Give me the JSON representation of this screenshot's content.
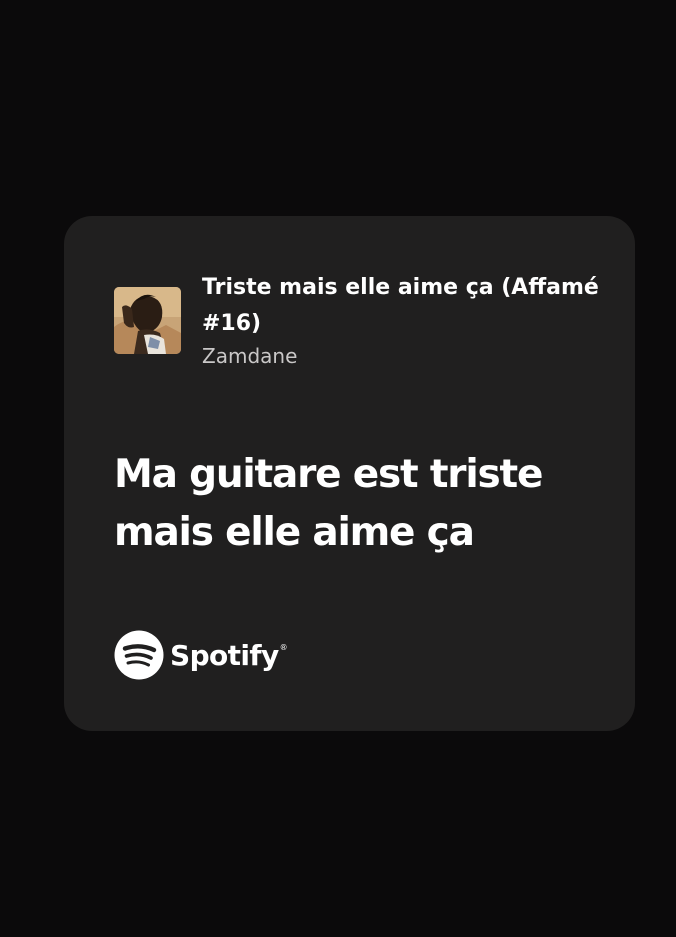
{
  "share_card": {
    "track": {
      "title": "Triste mais elle aime ça (Affamé #16)",
      "artist": "Zamdane",
      "cover_icon": "album-cover-image"
    },
    "lyric": "Ma guitare est triste mais elle aime ça",
    "brand": {
      "icon": "spotify-logo-icon",
      "name": "Spotify",
      "trademark": "®"
    },
    "colors": {
      "page_background": "#0b0a0b",
      "card_background": "#201f1f",
      "text_primary": "#ffffff",
      "text_secondary": "#c9c7c7"
    }
  }
}
